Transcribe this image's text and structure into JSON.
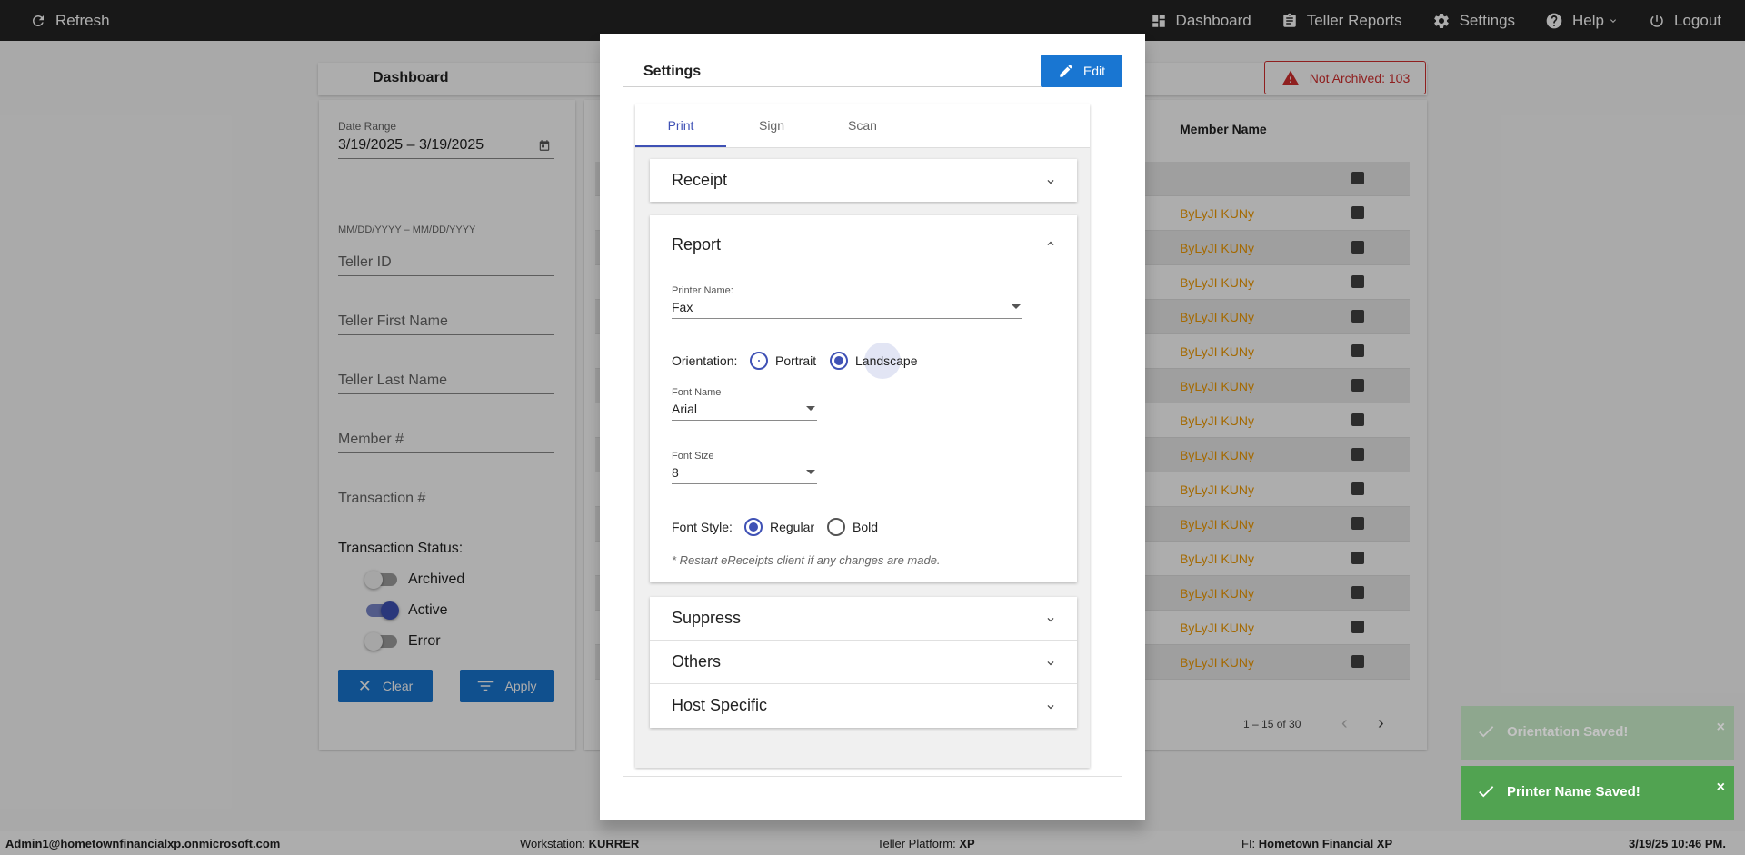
{
  "topbar": {
    "refresh_label": "Refresh",
    "nav": [
      "Dashboard",
      "Teller Reports",
      "Settings",
      "Help",
      "Logout"
    ]
  },
  "dashboard": {
    "title": "Dashboard",
    "not_archived": "Not Archived: 103",
    "filters": {
      "date_range_label": "Date Range",
      "date_range_value": "3/19/2025 – 3/19/2025",
      "date_hint": "MM/DD/YYYY – MM/DD/YYYY",
      "teller_id": "Teller ID",
      "teller_first_name": "Teller First Name",
      "teller_last_name": "Teller Last Name",
      "member_no": "Member #",
      "transaction_no": "Transaction #",
      "status_label": "Transaction Status:",
      "statuses": [
        {
          "label": "Archived",
          "on": false
        },
        {
          "label": "Active",
          "on": true
        },
        {
          "label": "Error",
          "on": false
        }
      ],
      "clear_label": "Clear",
      "apply_label": "Apply"
    },
    "table": {
      "member_header": "Member Name",
      "rows": [
        "",
        "ByLyJI KUNy",
        "ByLyJI KUNy",
        "ByLyJI KUNy",
        "ByLyJI KUNy",
        "ByLyJI KUNy",
        "ByLyJI KUNy",
        "ByLyJI KUNy",
        "ByLyJI KUNy",
        "ByLyJI KUNy",
        "ByLyJI KUNy",
        "ByLyJI KUNy",
        "ByLyJI KUNy",
        "ByLyJI KUNy",
        "ByLyJI KUNy"
      ],
      "pager_text": "1 – 15 of 30"
    }
  },
  "dialog": {
    "title": "Settings",
    "edit_label": "Edit",
    "tabs": [
      "Print",
      "Sign",
      "Scan"
    ],
    "active_tab": "Print",
    "panels": {
      "receipt": "Receipt",
      "report": "Report",
      "suppress": "Suppress",
      "others": "Others",
      "host_specific": "Host Specific"
    },
    "report": {
      "printer_label": "Printer Name:",
      "printer_value": "Fax",
      "orientation_label": "Orientation:",
      "portrait": "Portrait",
      "landscape": "Landscape",
      "orientation_selected": "Landscape",
      "font_name_label": "Font Name",
      "font_name_value": "Arial",
      "font_size_label": "Font Size",
      "font_size_value": "8",
      "font_style_label": "Font Style:",
      "regular": "Regular",
      "bold": "Bold",
      "font_style_selected": "Regular",
      "note": "* Restart eReceipts client if any changes are made."
    }
  },
  "toasts": [
    {
      "message": "Orientation Saved!",
      "close": "×"
    },
    {
      "message": "Printer Name Saved!",
      "close": "×"
    }
  ],
  "footer": {
    "user": "Admin1@hometownfinancialxp.onmicrosoft.com",
    "workstation_label": "Workstation:",
    "workstation_value": "KURRER",
    "platform_label": "Teller Platform:",
    "platform_value": "XP",
    "fi_label": "FI:",
    "fi_value": "Hometown Financial XP",
    "datetime": "3/19/25 10:46 PM."
  },
  "colors": {
    "accent": "#3f51b5",
    "button_blue": "#1976d2",
    "toast_green": "#51a351",
    "member_orange": "#f29b00",
    "alert_red": "#d32f2f"
  }
}
